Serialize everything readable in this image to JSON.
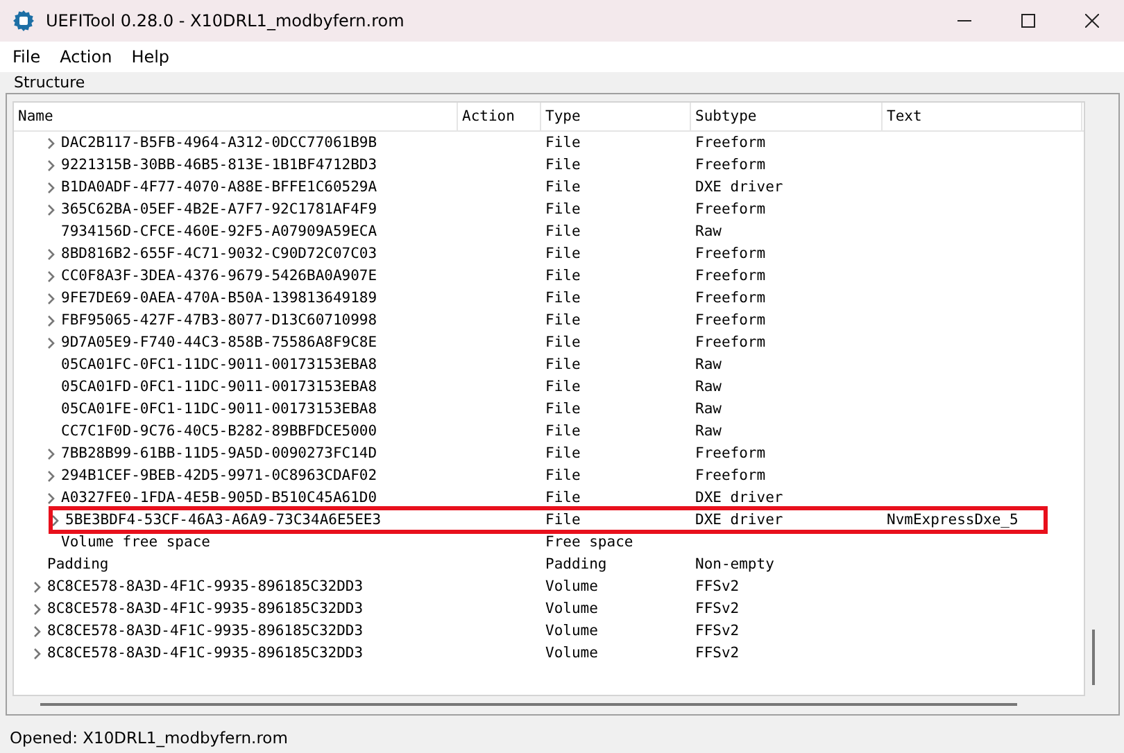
{
  "window": {
    "title": "UEFITool 0.28.0 - X10DRL1_modbyfern.rom"
  },
  "menu": [
    "File",
    "Action",
    "Help"
  ],
  "structure": {
    "label": "Structure",
    "columns": [
      "Name",
      "Action",
      "Type",
      "Subtype",
      "Text"
    ],
    "rows": [
      {
        "children": [
          {
            "name": "DAC2B117-B5FB-4964-A312-0DCC77061B9B",
            "type": "File",
            "subtype": "Freeform",
            "expandable": true,
            "highlighted": false
          },
          {
            "name": "9221315B-30BB-46B5-813E-1B1BF4712BD3",
            "type": "File",
            "subtype": "Freeform",
            "expandable": true,
            "highlighted": false
          },
          {
            "name": "B1DA0ADF-4F77-4070-A88E-BFFE1C60529A",
            "type": "File",
            "subtype": "DXE driver",
            "expandable": true,
            "highlighted": false
          },
          {
            "name": "365C62BA-05EF-4B2E-A7F7-92C1781AF4F9",
            "type": "File",
            "subtype": "Freeform",
            "expandable": true,
            "highlighted": false
          },
          {
            "name": "7934156D-CFCE-460E-92F5-A07909A59ECA",
            "type": "File",
            "subtype": "Raw",
            "expandable": false,
            "highlighted": false
          },
          {
            "name": "8BD816B2-655F-4C71-9032-C90D72C07C03",
            "type": "File",
            "subtype": "Freeform",
            "expandable": true,
            "highlighted": false
          },
          {
            "name": "CC0F8A3F-3DEA-4376-9679-5426BA0A907E",
            "type": "File",
            "subtype": "Freeform",
            "expandable": true,
            "highlighted": false
          },
          {
            "name": "9FE7DE69-0AEA-470A-B50A-139813649189",
            "type": "File",
            "subtype": "Freeform",
            "expandable": true,
            "highlighted": false
          },
          {
            "name": "FBF95065-427F-47B3-8077-D13C60710998",
            "type": "File",
            "subtype": "Freeform",
            "expandable": true,
            "highlighted": false
          },
          {
            "name": "9D7A05E9-F740-44C3-858B-75586A8F9C8E",
            "type": "File",
            "subtype": "Freeform",
            "expandable": true,
            "highlighted": false
          },
          {
            "name": "05CA01FC-0FC1-11DC-9011-00173153EBA8",
            "type": "File",
            "subtype": "Raw",
            "expandable": false,
            "highlighted": false
          },
          {
            "name": "05CA01FD-0FC1-11DC-9011-00173153EBA8",
            "type": "File",
            "subtype": "Raw",
            "expandable": false,
            "highlighted": false
          },
          {
            "name": "05CA01FE-0FC1-11DC-9011-00173153EBA8",
            "type": "File",
            "subtype": "Raw",
            "expandable": false,
            "highlighted": false
          },
          {
            "name": "CC7C1F0D-9C76-40C5-B282-89BBFDCE5000",
            "type": "File",
            "subtype": "Raw",
            "expandable": false,
            "highlighted": false
          },
          {
            "name": "7BB28B99-61BB-11D5-9A5D-0090273FC14D",
            "type": "File",
            "subtype": "Freeform",
            "expandable": true,
            "highlighted": false
          },
          {
            "name": "294B1CEF-9BEB-42D5-9971-0C8963CDAF02",
            "type": "File",
            "subtype": "Freeform",
            "expandable": true,
            "highlighted": false
          },
          {
            "name": "A0327FE0-1FDA-4E5B-905D-B510C45A61D0",
            "type": "File",
            "subtype": "DXE driver",
            "expandable": true,
            "highlighted": false
          },
          {
            "name": "5BE3BDF4-53CF-46A3-A6A9-73C34A6E5EE3",
            "type": "File",
            "subtype": "DXE driver",
            "text": "NvmExpressDxe_5",
            "expandable": true,
            "highlighted": true
          },
          {
            "name": "Volume free space",
            "type": "Free space",
            "expandable": false,
            "highlighted": false
          }
        ]
      },
      {
        "name": "Padding",
        "type": "Padding",
        "subtype": "Non-empty",
        "expandable": false,
        "highlighted": false
      },
      {
        "name": "8C8CE578-8A3D-4F1C-9935-896185C32DD3",
        "type": "Volume",
        "subtype": "FFSv2",
        "expandable": true,
        "highlighted": false
      },
      {
        "name": "8C8CE578-8A3D-4F1C-9935-896185C32DD3",
        "type": "Volume",
        "subtype": "FFSv2",
        "expandable": true,
        "highlighted": false
      },
      {
        "name": "8C8CE578-8A3D-4F1C-9935-896185C32DD3",
        "type": "Volume",
        "subtype": "FFSv2",
        "expandable": true,
        "highlighted": false
      },
      {
        "name": "8C8CE578-8A3D-4F1C-9935-896185C32DD3",
        "type": "Volume",
        "subtype": "FFSv2",
        "expandable": true,
        "highlighted": false
      }
    ]
  },
  "status_bar": "Opened: X10DRL1_modbyfern.rom"
}
